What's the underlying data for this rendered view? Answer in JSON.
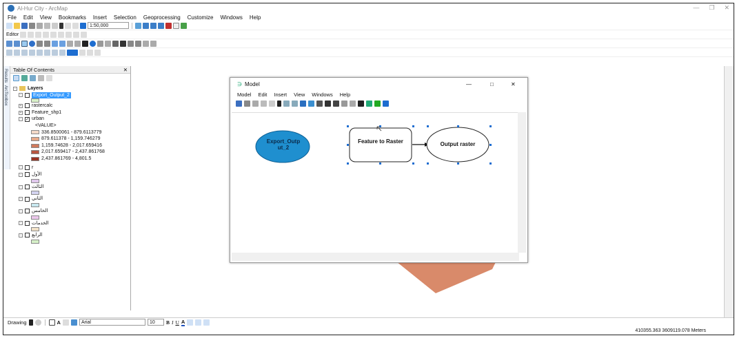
{
  "window": {
    "title": "Al-Hur City - ArcMap"
  },
  "menubar": [
    "File",
    "Edit",
    "View",
    "Bookmarks",
    "Insert",
    "Selection",
    "Geoprocessing",
    "Customize",
    "Windows",
    "Help"
  ],
  "toolbar": {
    "scale": "1:50,000",
    "editor_label": "Editor"
  },
  "toc": {
    "title": "Table Of Contents",
    "pin": "✕",
    "sidetabs": [
      "Results",
      "ArcToolbox"
    ],
    "root": "Layers",
    "layers": [
      {
        "name": "Export_Output_2",
        "checked": false,
        "highlight": true,
        "swatch": "#d8f0c8"
      },
      {
        "name": "rastercalc",
        "checked": false
      },
      {
        "name": "Feature_shp1",
        "checked": false
      },
      {
        "name": "urban",
        "checked": true
      }
    ],
    "value_header": "<VALUE>",
    "classes": [
      {
        "label": "336.8500061 - 879.6113779",
        "color": "#f4d9c8"
      },
      {
        "label": "879.611378 - 1,159.746279",
        "color": "#e6a98a"
      },
      {
        "label": "1,159.74628 - 2,017.659416",
        "color": "#d07a5c"
      },
      {
        "label": "2,017.659417 - 2,437.861768",
        "color": "#b85640"
      },
      {
        "label": "2,437.861769 - 4,801.5",
        "color": "#9a3323"
      }
    ],
    "extra_layers": [
      {
        "name": "r",
        "swatch": null
      },
      {
        "name": "الأول",
        "swatch": "#e0c8ec"
      },
      {
        "name": "الثالث",
        "swatch": "#d4d4f0"
      },
      {
        "name": "الثاني",
        "swatch": "#c8e8f0"
      },
      {
        "name": "الخامس",
        "swatch": "#ecc8ec"
      },
      {
        "name": "الخدمات",
        "swatch": "#f2e2c8"
      },
      {
        "name": "الرابع",
        "swatch": "#d6f0c8"
      }
    ]
  },
  "model": {
    "title": "Model",
    "menu": [
      "Model",
      "Edit",
      "Insert",
      "View",
      "Windows",
      "Help"
    ],
    "input": "Export_Outp ut_2",
    "tool": "Feature to Raster",
    "output": "Output raster",
    "colors": {
      "input": "#1f8fcf",
      "output": "#ffffff",
      "tool": "#ffffff"
    }
  },
  "drawing": {
    "label": "Drawing",
    "font": "Arial",
    "size": "10"
  },
  "status": {
    "coords": "410355.363 3609119.078 Meters"
  }
}
